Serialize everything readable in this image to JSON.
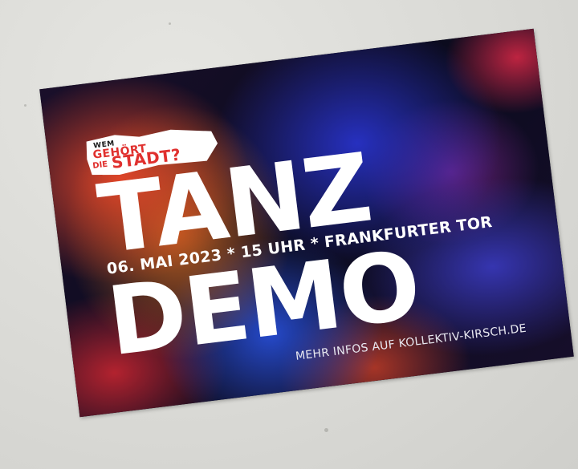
{
  "poster": {
    "logo": {
      "small_text": "WEM",
      "line_gehoert": "GEHÖRT",
      "line_die": "DIE",
      "line_stadt": "STADT?"
    },
    "title_line_1": "TANZ",
    "title_line_2": "DEMO",
    "info_line": "06. MAI 2023 * 15 UHR * FRANKFURTER TOR",
    "more_info": "MEHR INFOS AUF KOLLEKTIV-KIRSCH.DE"
  },
  "colors": {
    "wall": "#dcdcd8",
    "sticker_dark": "#0d0d1c",
    "accent_red": "#e0302e",
    "accent_blue": "#2832c8",
    "text_white": "#ffffff"
  }
}
